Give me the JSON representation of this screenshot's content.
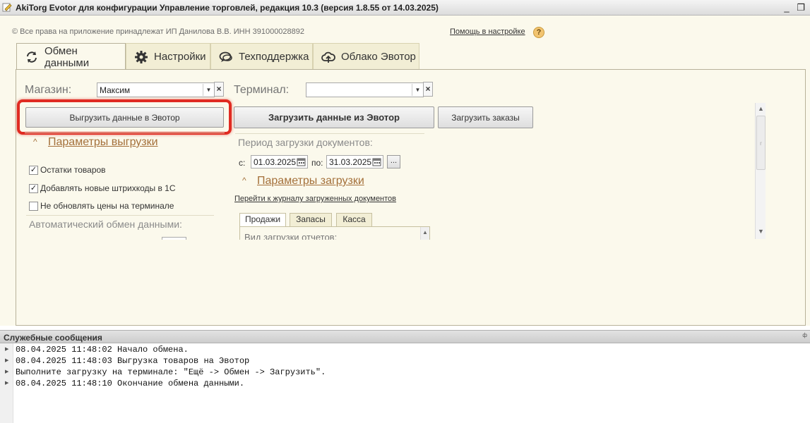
{
  "window": {
    "title": "AkiTorg Evotor для конфигурации Управление торговлей, редакция 10.3 (версия 1.8.55 от 14.03.2025)",
    "minimize_glyph": "_",
    "restore_glyph": "❐",
    "close_glyph": "×"
  },
  "header": {
    "copyright": "© Все права на приложение принадлежат ИП Данилова В.В.  ИНН 391000028892",
    "help_link": "Помощь в настройке",
    "help_icon_glyph": "?"
  },
  "tabs": [
    {
      "label": "Обмен данными",
      "icon": "sync-icon",
      "active": true
    },
    {
      "label": "Настройки",
      "icon": "gear-icon",
      "active": false
    },
    {
      "label": "Техподдержка",
      "icon": "chat-icon",
      "active": false
    },
    {
      "label": "Облако Эвотор",
      "icon": "cloud-upload-icon",
      "active": false
    }
  ],
  "shop": {
    "label": "Магазин:",
    "value": "Максим"
  },
  "terminal": {
    "label": "Терминал:",
    "value": ""
  },
  "controls": {
    "dropdown_glyph": "▼",
    "clear_glyph": "×",
    "dots_glyph": "..."
  },
  "buttons": {
    "upload": "Выгрузить данные в Эвотор",
    "download": "Загрузить данные из Эвотор",
    "orders": "Загрузить заказы"
  },
  "export_params": {
    "caret": "^",
    "title": "Параметры выгрузки",
    "checkboxes": [
      {
        "label": "Остатки товаров",
        "checked": true
      },
      {
        "label": "Добавлять новые штрихкоды в 1С",
        "checked": true
      },
      {
        "label": "Не обновлять цены на терминале",
        "checked": false
      }
    ],
    "auto_exchange_label": "Автоматический обмен данными:"
  },
  "period": {
    "label": "Период загрузки документов:",
    "from_label": "с:",
    "from": "01.03.2025",
    "to_label": "по:",
    "to": "31.03.2025"
  },
  "import_params": {
    "caret": "^",
    "title": "Параметры загрузки",
    "journal_link": "Перейти к журналу загруженных документов",
    "subtabs": [
      {
        "label": "Продажи",
        "active": true
      },
      {
        "label": "Запасы",
        "active": false
      },
      {
        "label": "Касса",
        "active": false
      }
    ],
    "subpanel_text": "Вид загрузки отчетов:"
  },
  "scrollbar": {
    "up_glyph": "▲",
    "down_glyph": "▼",
    "thumb_glyph": "r"
  },
  "messages": {
    "title": "Служебные сообщения",
    "pin_glyph": "ф",
    "arrow_glyph": "▶",
    "items": [
      "08.04.2025 11:48:02 Начало обмена.",
      "08.04.2025 11:48:03 Выгрузка товаров на Эвотор",
      "Выполните загрузку на терминале: \"Ещё -> Обмен -> Загрузить\".",
      "08.04.2025 11:48:10 Окончание обмена данными."
    ]
  },
  "colors": {
    "form_bg": "#fbf9ec",
    "accent_link": "#a4703a",
    "highlight": "#e02b22"
  }
}
